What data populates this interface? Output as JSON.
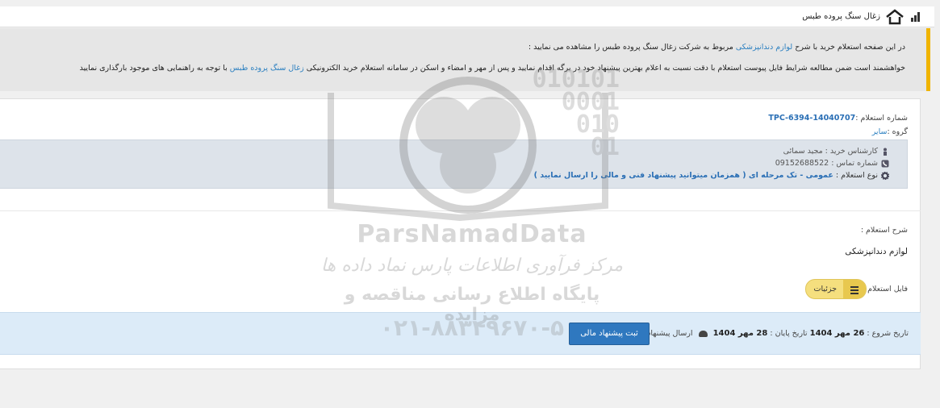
{
  "header": {
    "title": "زغال سنگ پروده طبس"
  },
  "intro": {
    "line1_a": "در این صفحه استعلام خرید با شرح ",
    "line1_link": "لوازم دندانپزشکی",
    "line1_b": " مربوط به شرکت زغال سنگ پروده طبس را مشاهده می نمایید :",
    "line2_a": "خواهشمند است ضمن مطالعه شرایط فایل پیوست استعلام با دقت نسبت به اعلام بهترین پیشنهاد خود در برگه اقدام نمایید و پس از مهر و امضاء و اسکن در سامانه استعلام خرید الکترونیکی ",
    "line2_link": "زغال سنگ پروده طبس",
    "line2_b": " با توجه به راهنمایی های موجود بارگذاری نمایید"
  },
  "inquiry": {
    "number_label": "شماره استعلام :",
    "number_value": "TPC-6394-14040707",
    "group_label": "گروه :",
    "group_value": "سایر",
    "expert": "کارشناس خرید : مجید سمائی",
    "phone": "شماره تماس : 09152688522",
    "type_label": "نوع استعلام : ",
    "type_value": "عمومی - تک مرحله ای ( همزمان میتوانید پیشنهاد فنی و مالی را ارسال نمایید )",
    "desc_label": "شرح استعلام :",
    "desc_value": "لوازم دندانپزشکی",
    "file_label": "فایل استعلام بهاء :",
    "details_button": "جزئیات"
  },
  "footer": {
    "start_label": "تاریخ شروع :",
    "start_value": "26 مهر 1404",
    "end_label": "تاریخ پایان :",
    "end_value": "28 مهر 1404",
    "send_label": "ارسال پیشنهاد :",
    "submit_button": "ثبت پیشنهاد مالی"
  },
  "watermark": {
    "brand": "ParsNamadData",
    "line_fa1": "مرکز فرآوری اطلاعات پارس نماد داده ها",
    "line_fa2": "پایگاه اطلاع رسانی مناقصه و مزایده",
    "phone": "۰۲۱-۸۸۳۴۹۶۷۰-۵",
    "digits": "010101\n0001\n010\n01"
  },
  "colors": {
    "accent": "#f0b400",
    "link": "#2a7fc0",
    "submit": "#2f78bf",
    "footer_bg": "#dcebf8"
  }
}
